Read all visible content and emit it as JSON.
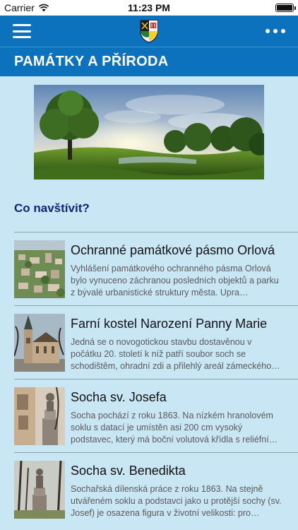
{
  "status_bar": {
    "carrier": "Carrier",
    "time": "11:23 PM",
    "battery_level": 1.0
  },
  "nav": {
    "menu_icon": "hamburger-menu-icon",
    "logo_icon": "city-crest-icon",
    "more_icon": "more-dots-icon"
  },
  "page": {
    "title": "PAMÁTKY A PŘÍRODA"
  },
  "banner": {
    "image": "landscape-photo"
  },
  "section": {
    "heading": "Co navštívit?"
  },
  "items": [
    {
      "title": "Ochranné památkové pásmo Orlová",
      "description": "Vyhlášení památkového ochranného pásma Orlová bylo vynuceno záchranou posledních objektů a parku z bývalé urbanistické struktury města. Upra…"
    },
    {
      "title": "Farní kostel Narození Panny Marie",
      "description": "Jedná se o novogotickou stavbu dostavěnou v počátku 20. století k níž patří soubor soch se schodištěm, ohradní zdi a přilehlý areál zámeckého…"
    },
    {
      "title": "Socha sv. Josefa",
      "description": "Socha pochází z roku 1863. Na nízkém hranolovém soklu s datací je umístěn asi 200 cm vysoký podstavec, který má boční volutová křídla s reliéfní…"
    },
    {
      "title": "Socha sv. Benedikta",
      "description": "Sochařská dílenská práce z roku 1863. Na stejně utvářeném soklu a podstavci jako u protější sochy (sv. Josef) je osazena figura v životní velikosti: pro…"
    }
  ]
}
